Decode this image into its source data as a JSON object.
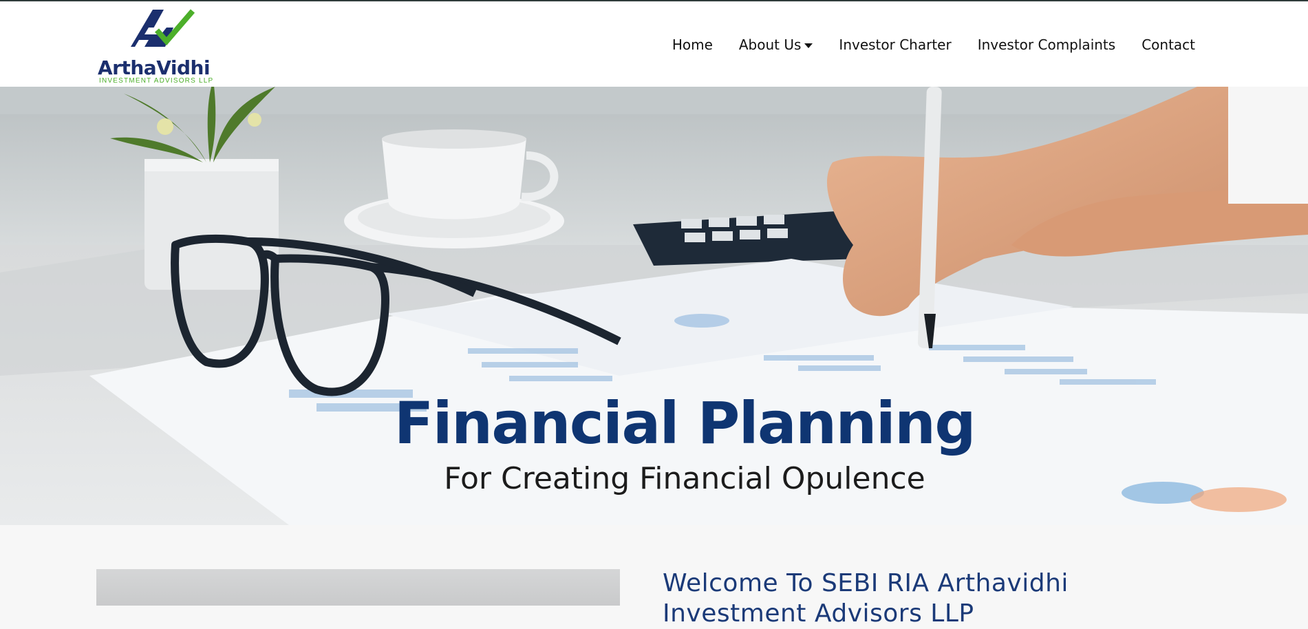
{
  "brand": {
    "name": "ArthaVidhi",
    "tagline": "INVESTMENT ADVISORS LLP",
    "primary_color": "#1b2f6e",
    "accent_color": "#4caf2a"
  },
  "nav": {
    "items": [
      {
        "label": "Home",
        "has_dropdown": false
      },
      {
        "label": "About Us",
        "has_dropdown": true
      },
      {
        "label": "Investor Charter",
        "has_dropdown": false
      },
      {
        "label": "Investor Complaints",
        "has_dropdown": false
      },
      {
        "label": "Contact",
        "has_dropdown": false
      }
    ]
  },
  "hero": {
    "title": "Financial Planning",
    "subtitle": "For Creating Financial Opulence",
    "title_color": "#0f3572"
  },
  "welcome": {
    "heading": "Welcome To SEBI RIA Arthavidhi Investment Advisors LLP"
  }
}
